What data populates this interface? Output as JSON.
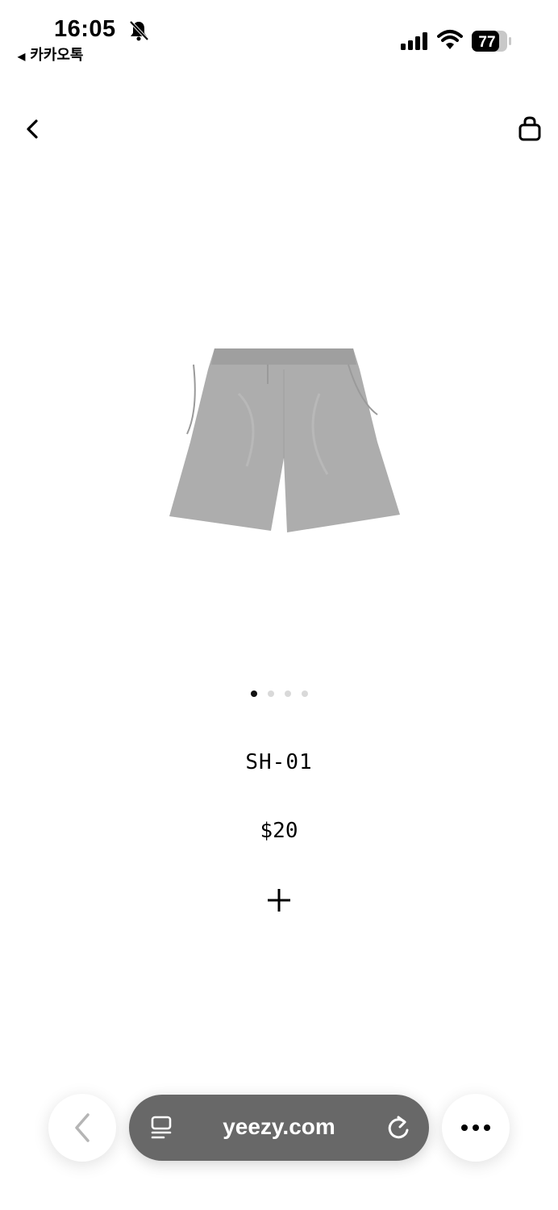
{
  "status_bar": {
    "time": "16:05",
    "back_app": "카카오톡",
    "battery": "77"
  },
  "product": {
    "name": "SH-01",
    "price": "$20",
    "image_count": 4,
    "active_image": 1
  },
  "browser": {
    "url": "yeezy.com"
  },
  "icons": {
    "nav_back": "chevron-left-icon",
    "bag": "shopping-bag-icon",
    "add": "plus-icon",
    "tabs": "tabs-icon",
    "reload": "reload-icon",
    "more": "more-icon"
  }
}
